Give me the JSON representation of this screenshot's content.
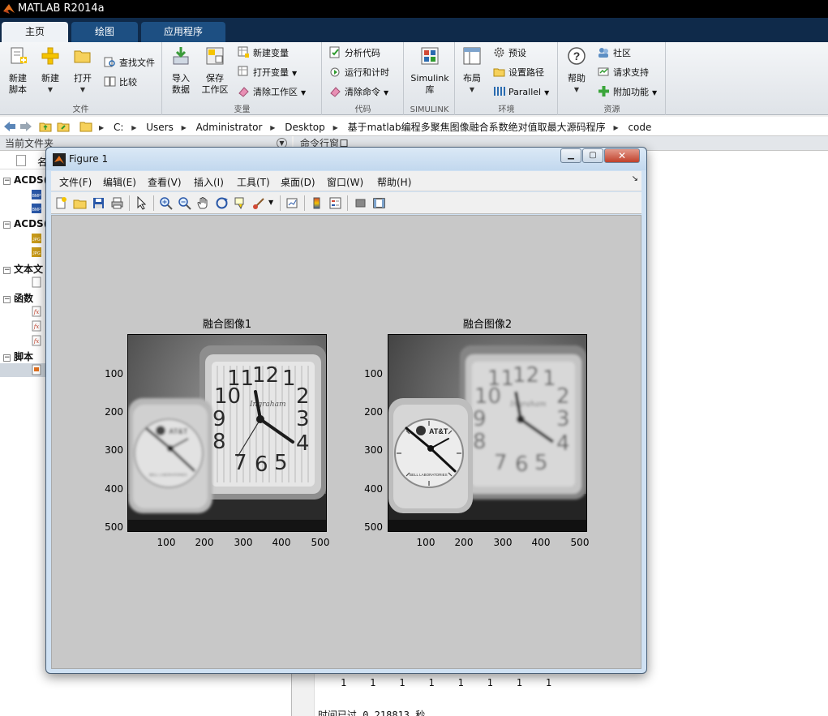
{
  "app": {
    "title": "MATLAB R2014a"
  },
  "tabs": [
    {
      "label": "主页",
      "active": true
    },
    {
      "label": "绘图",
      "active": false
    },
    {
      "label": "应用程序",
      "active": false
    }
  ],
  "ribbon": {
    "file": {
      "group_label": "文件",
      "new_script": [
        "新建",
        "脚本"
      ],
      "new": "新建",
      "open": "打开",
      "find_files": "查找文件",
      "compare": "比较"
    },
    "variable": {
      "group_label": "变量",
      "import": [
        "导入",
        "数据"
      ],
      "save": [
        "保存",
        "工作区"
      ],
      "new_variable": "新建变量",
      "open_variable": "打开变量",
      "clear_workspace": "清除工作区"
    },
    "code": {
      "group_label": "代码",
      "analyze": "分析代码",
      "run_time": "运行和计时",
      "clear_commands": "清除命令"
    },
    "simulink": {
      "group_label": "SIMULINK",
      "library": [
        "Simulink",
        "库"
      ]
    },
    "environment": {
      "group_label": "环境",
      "layout": "布局",
      "preferences": "预设",
      "set_path": "设置路径",
      "parallel": "Parallel"
    },
    "resources": {
      "group_label": "资源",
      "help": "帮助",
      "community": "社区",
      "request_support": "请求支持",
      "add_ons": "附加功能"
    }
  },
  "address": {
    "crumbs": [
      "C:",
      "Users",
      "Administrator",
      "Desktop",
      "基于matlab编程多聚焦图像融合系数绝对值取最大源码程序",
      "code"
    ]
  },
  "current_folder": {
    "header": "当前文件夹",
    "column_name": "名",
    "groups": [
      "ACDS(",
      "ACDS(",
      "文本文",
      "函数",
      "脚本"
    ]
  },
  "command_window": {
    "header": "命令行窗口",
    "ones_row": "1    1    1    1    1    1    1    1",
    "elapsed": "时间已过 0.218813 秒。"
  },
  "figure": {
    "title": "Figure 1",
    "menu": [
      "文件(F)",
      "编辑(E)",
      "查看(V)",
      "插入(I)",
      "工具(T)",
      "桌面(D)",
      "窗口(W)",
      "帮助(H)"
    ],
    "axes": [
      {
        "title": "融合图像1",
        "yticks": [
          "100",
          "200",
          "300",
          "400",
          "500"
        ],
        "xticks": [
          "100",
          "200",
          "300",
          "400",
          "500"
        ],
        "focus": "right"
      },
      {
        "title": "融合图像2",
        "yticks": [
          "100",
          "200",
          "300",
          "400",
          "500"
        ],
        "xticks": [
          "100",
          "200",
          "300",
          "400",
          "500"
        ],
        "focus": "left"
      }
    ],
    "clock_big": {
      "numbers": [
        "11",
        "12",
        "1",
        "2",
        "10",
        "3",
        "9",
        "8",
        "4",
        "7",
        "6",
        "5"
      ],
      "brand": "Ingraham"
    },
    "clock_small": {
      "brand": "AT&T",
      "sub": "BELL LABORATORIES"
    }
  }
}
